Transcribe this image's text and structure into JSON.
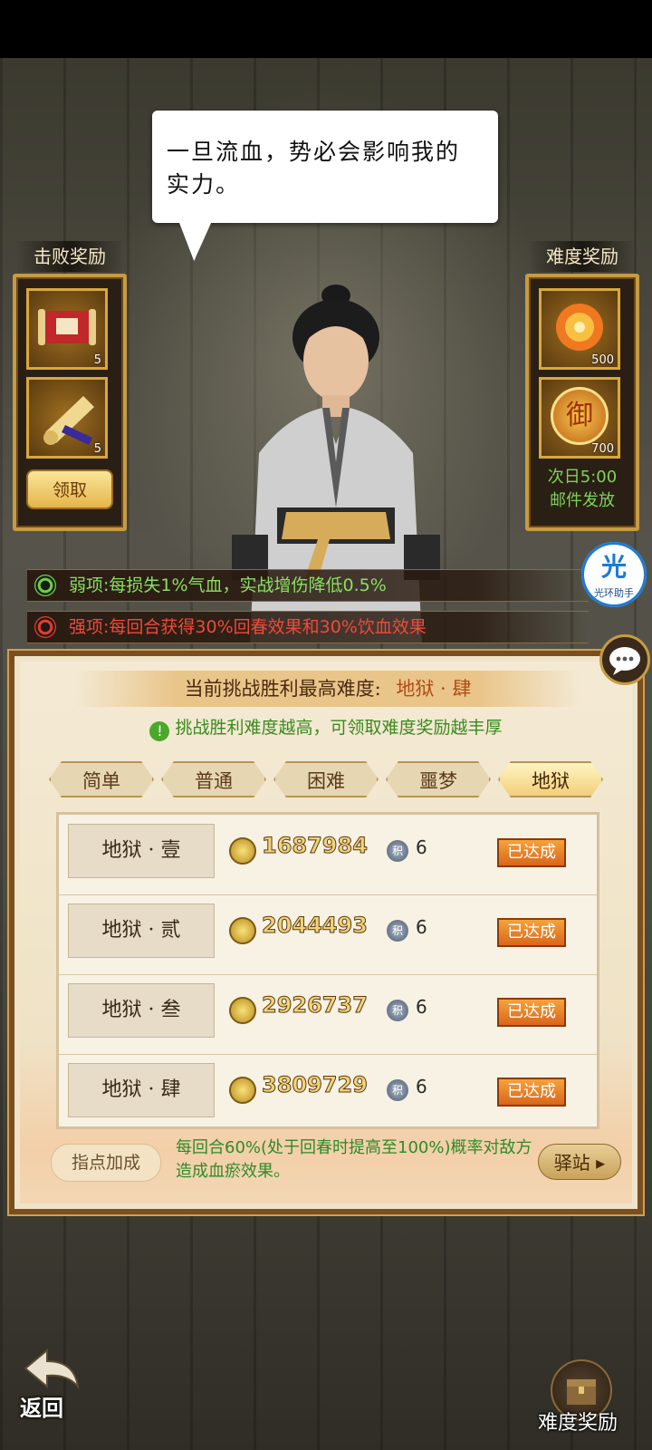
{
  "dialogue": "一旦流血，势必会影响我的实力。",
  "defeat_rewards": {
    "title": "击败奖励",
    "items": [
      {
        "icon": "scroll-icon",
        "count": "5"
      },
      {
        "icon": "rolled-scroll-icon",
        "count": "5"
      }
    ],
    "claim_label": "领取"
  },
  "difficulty_rewards": {
    "title": "难度奖励",
    "items": [
      {
        "icon": "flame-flower-icon",
        "count": "500"
      },
      {
        "icon": "seal-coin-icon",
        "count": "700",
        "glyph": "御"
      }
    ],
    "note_line1": "次日5:00",
    "note_line2": "邮件发放"
  },
  "buffs": {
    "weak": "弱项:每损失1%气血，实战增伤降低0.5%",
    "strong": "强项:每回合获得30%回春效果和30%饮血效果"
  },
  "helper": {
    "glyph": "光",
    "label": "光环助手"
  },
  "challenge": {
    "banner_prefix": "当前挑战胜利最高难度:",
    "banner_value": "地狱 · 肆",
    "tip": "挑战胜利难度越高，可领取难度奖励越丰厚",
    "tip_icon": "!",
    "tabs": [
      "简单",
      "普通",
      "困难",
      "噩梦",
      "地狱"
    ],
    "active_tab": 4,
    "rows": [
      {
        "label": "地狱 · 壹",
        "score": "1687984",
        "badge_glyph": "积",
        "badge_count": "6",
        "status": "已达成"
      },
      {
        "label": "地狱 · 贰",
        "score": "2044493",
        "badge_glyph": "积",
        "badge_count": "6",
        "status": "已达成"
      },
      {
        "label": "地狱 · 叁",
        "score": "2926737",
        "badge_glyph": "积",
        "badge_count": "6",
        "status": "已达成"
      },
      {
        "label": "地狱 · 肆",
        "score": "3809729",
        "badge_glyph": "积",
        "badge_count": "6",
        "status": "已达成"
      }
    ],
    "guide_label": "指点加成",
    "guide_text": "每回合60%(处于回春时提高至100%)概率对敌方造成血瘀效果。",
    "station_label": "驿站"
  },
  "bottom": {
    "back_label": "返回",
    "difficulty_reward_label": "难度奖励"
  }
}
